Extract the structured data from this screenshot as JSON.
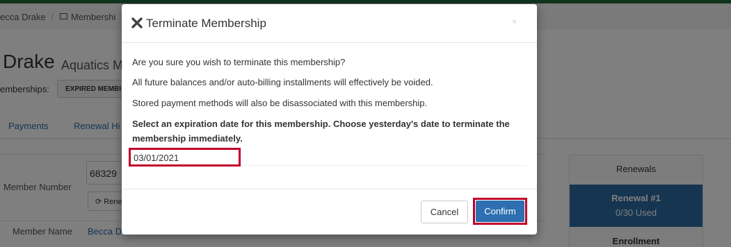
{
  "background": {
    "breadcrumb": [
      "ecca Drake",
      "/",
      "Membershi"
    ],
    "title": "Drake",
    "subtitle": "Aquatics M",
    "memberships_label": "emberships:",
    "expired_button": "EXPIRED MEMBI",
    "tabs": [
      "Payments",
      "Renewal Hi"
    ],
    "member_number_label": "Member Number",
    "member_number_value": "68329",
    "renew_button": "Rene",
    "member_name_label": "Member Name",
    "member_name_value": "Becca D",
    "renewals_header": "Renewals",
    "renewal_card_title": "Renewal #1",
    "renewal_card_used": "0/30 Used",
    "enrollment_label": "Enrollment"
  },
  "modal": {
    "title": "Terminate Membership",
    "close": "×",
    "line1": "Are you sure you wish to terminate this membership?",
    "line2": "All future balances and/or auto-billing installments will effectively be voided.",
    "line3": "Stored payment methods will also be disassociated with this membership.",
    "instruction_line1": "Select an expiration date for this membership. Choose yesterday's date to terminate the",
    "instruction_line2": "membership immediately.",
    "expiration_date": "03/01/2021",
    "cancel_label": "Cancel",
    "confirm_label": "Confirm"
  },
  "colors": {
    "topbar": "#1e6b3a",
    "primary_button": "#2d6fb0",
    "highlight": "#c0002a"
  }
}
